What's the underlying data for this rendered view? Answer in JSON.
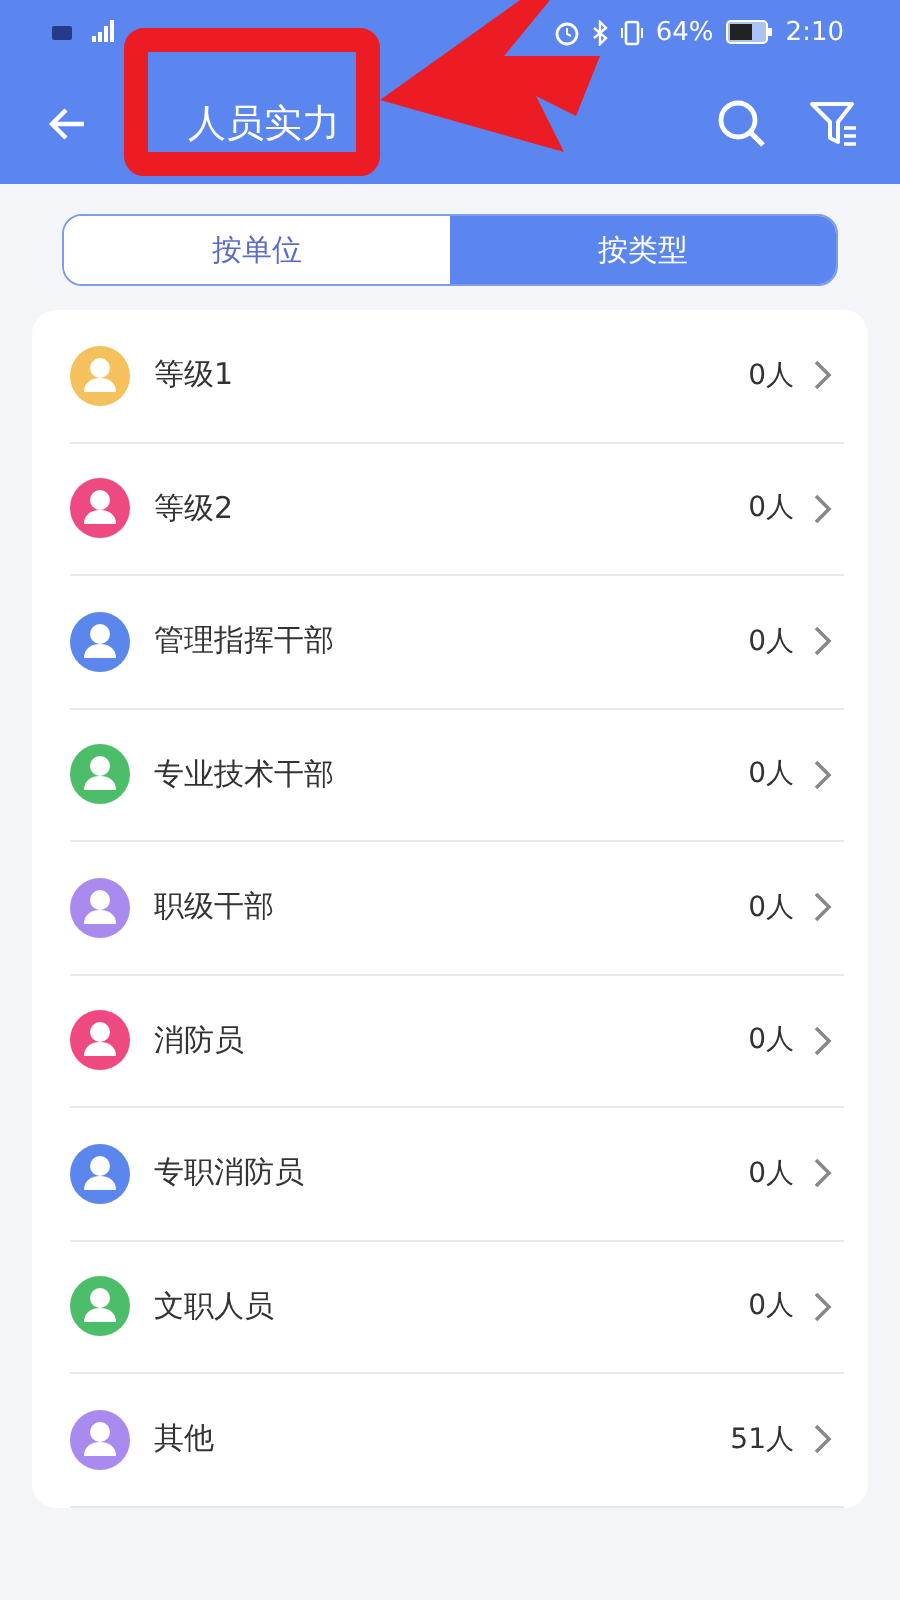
{
  "status_bar": {
    "battery": "64%",
    "time": "2:10"
  },
  "header": {
    "title": "人员实力"
  },
  "tabs": [
    {
      "label": "按单位",
      "selected": false
    },
    {
      "label": "按类型",
      "selected": true
    }
  ],
  "items": [
    {
      "name": "等级1",
      "count": "0人",
      "color": "#f5c15c"
    },
    {
      "name": "等级2",
      "count": "0人",
      "color": "#ee4a7f"
    },
    {
      "name": "管理指挥干部",
      "count": "0人",
      "color": "#5b86ec"
    },
    {
      "name": "专业技术干部",
      "count": "0人",
      "color": "#4cbd69"
    },
    {
      "name": "职级干部",
      "count": "0人",
      "color": "#a98bf0"
    },
    {
      "name": "消防员",
      "count": "0人",
      "color": "#ee4a7f"
    },
    {
      "name": "专职消防员",
      "count": "0人",
      "color": "#5b86ec"
    },
    {
      "name": "文职人员",
      "count": "0人",
      "color": "#4cbd69"
    },
    {
      "name": "其他",
      "count": "51人",
      "color": "#a98bf0"
    }
  ]
}
